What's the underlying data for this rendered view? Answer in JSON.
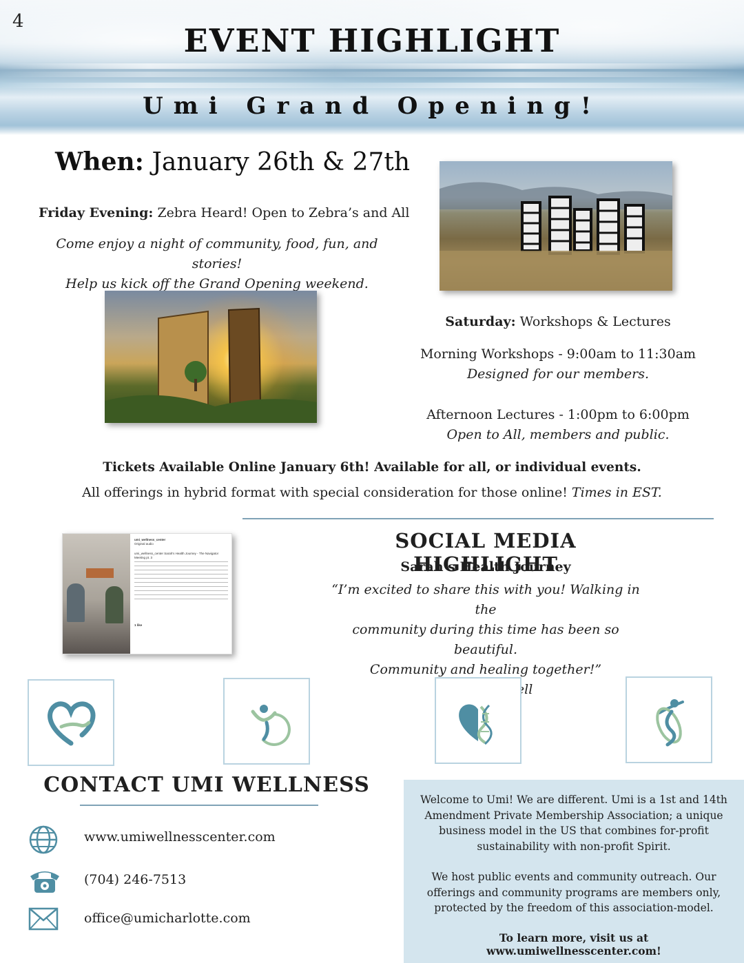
{
  "page_number": "4",
  "banner": {
    "title": "EVENT HIGHLIGHT",
    "subtitle": "Umi Grand Opening!"
  },
  "when": {
    "label": "When:",
    "value": "January 26th & 27th"
  },
  "friday": {
    "label": "Friday Evening:",
    "text": "Zebra Heard! Open to Zebra’s and All",
    "desc_line1": "Come enjoy a night of community, food, fun, and stories!",
    "desc_line2": "Help us kick off the Grand Opening weekend."
  },
  "saturday": {
    "label": "Saturday:",
    "text": "Workshops & Lectures",
    "morning": "Morning Workshops - 9:00am to 11:30am",
    "morning_note": "Designed for our members.",
    "afternoon": "Afternoon Lectures - 1:00pm to 6:00pm",
    "afternoon_note": "Open to All, members and public."
  },
  "tickets": "Tickets Available Online January 6th! Available for all, or individual events.",
  "offerings": {
    "text": "All offerings in hybrid format with special consideration for those online!",
    "times_note": "Times in EST."
  },
  "social": {
    "title": "SOCIAL MEDIA HIGHLIGHT",
    "name": "Sarah’s Health Journey",
    "quote_line1": "“I’m excited to share this with you! Walking in the",
    "quote_line2": "community during this time has been so beautiful.",
    "quote_line3": "Community and healing together!”",
    "attribution": "-Sarah Halsell",
    "post": {
      "account": "umi_wellness_center",
      "audio": "Original audio",
      "caption": "umi_wellness_center Sarah's Health Journey - The Navigator Meeting pt. 3",
      "likes": "1 like"
    }
  },
  "icons": [
    "heart-hands-icon",
    "wellness-figure-icon",
    "heart-dna-icon",
    "dna-figure-icon"
  ],
  "contact": {
    "title": "CONTACT UMI WELLNESS",
    "website": "www.umiwellnesscenter.com",
    "phone": "(704) 246-7513",
    "email": "office@umicharlotte.com"
  },
  "welcome": {
    "p1": "Welcome to Umi!  We are different. Umi is a 1st and 14th Amendment Private Membership Association; a unique business model in the US that combines for-profit sustainability with non-profit Spirit.",
    "p2": "We host public events and community outreach. Our offerings and community programs are members only, protected by the freedom of this association-model.",
    "cta": "To learn more, visit us at www.umiwellnesscenter.com!"
  },
  "colors": {
    "accent": "#7fa2b6",
    "icon_teal": "#4f8ea3",
    "icon_green": "#9cc4a0",
    "box_bg": "#d4e5ee",
    "icon_border": "#b9d3e0"
  }
}
